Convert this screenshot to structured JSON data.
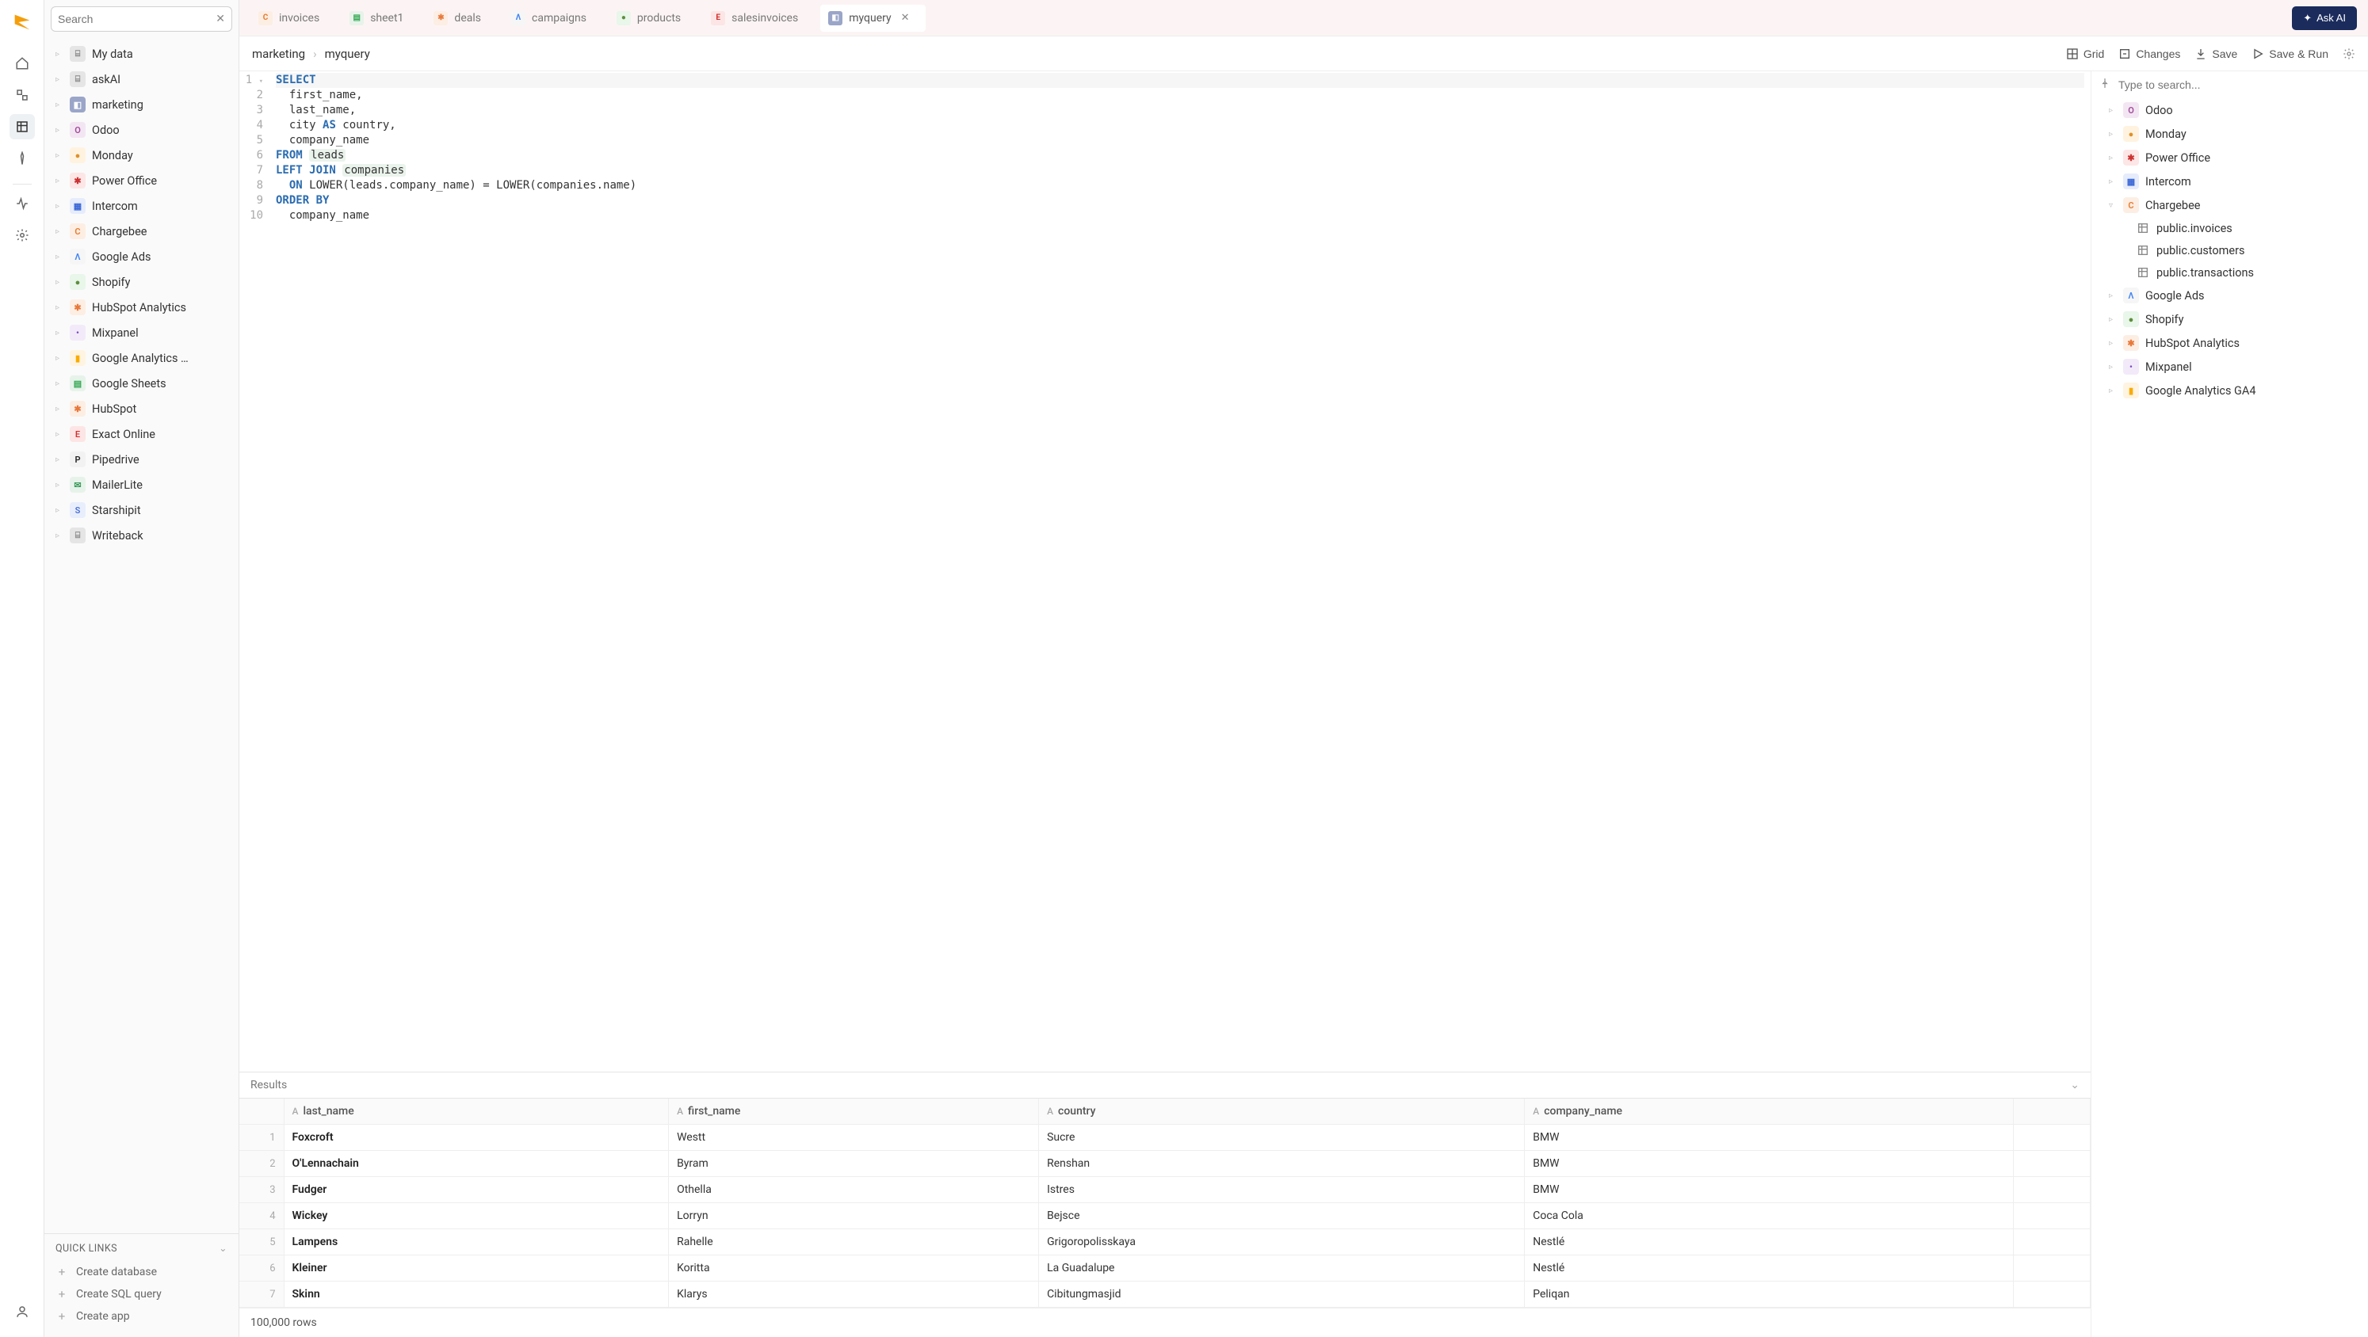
{
  "search": {
    "placeholder": "Search"
  },
  "sidebar": {
    "items": [
      {
        "label": "My data",
        "iconBg": "#e5e5e5",
        "iconFg": "#888",
        "glyph": "⌸"
      },
      {
        "label": "askAI",
        "iconBg": "#e5e5e5",
        "iconFg": "#888",
        "glyph": "⌸"
      },
      {
        "label": "marketing",
        "iconBg": "#9aa5c8",
        "iconFg": "#fff",
        "glyph": "◧"
      },
      {
        "label": "Odoo",
        "iconBg": "#f3e6f3",
        "iconFg": "#a24a9a",
        "glyph": "O"
      },
      {
        "label": "Monday",
        "iconBg": "#fff3e0",
        "iconFg": "#e08f2a",
        "glyph": "●"
      },
      {
        "label": "Power Office",
        "iconBg": "#fde6e6",
        "iconFg": "#c33",
        "glyph": "✱"
      },
      {
        "label": "Intercom",
        "iconBg": "#e6ecfb",
        "iconFg": "#3a66d6",
        "glyph": "▦"
      },
      {
        "label": "Chargebee",
        "iconBg": "#fdeee3",
        "iconFg": "#e77b2f",
        "glyph": "C"
      },
      {
        "label": "Google Ads",
        "iconBg": "#f6f6f6",
        "iconFg": "#4285f4",
        "glyph": "Λ"
      },
      {
        "label": "Shopify",
        "iconBg": "#e9f6ea",
        "iconFg": "#5e8e3e",
        "glyph": "●"
      },
      {
        "label": "HubSpot Analytics",
        "iconBg": "#fdeee4",
        "iconFg": "#e8793b",
        "glyph": "✱"
      },
      {
        "label": "Mixpanel",
        "iconBg": "#f2eaf9",
        "iconFg": "#7b49c6",
        "glyph": "•"
      },
      {
        "label": "Google Analytics …",
        "iconBg": "#fff4e1",
        "iconFg": "#f9ab00",
        "glyph": "▮"
      },
      {
        "label": "Google Sheets",
        "iconBg": "#e7f3ea",
        "iconFg": "#34a853",
        "glyph": "▤"
      },
      {
        "label": "HubSpot",
        "iconBg": "#fdeee4",
        "iconFg": "#e8793b",
        "glyph": "✱"
      },
      {
        "label": "Exact Online",
        "iconBg": "#fde5e5",
        "iconFg": "#d32f2f",
        "glyph": "E"
      },
      {
        "label": "Pipedrive",
        "iconBg": "#f2f2f2",
        "iconFg": "#222",
        "glyph": "P"
      },
      {
        "label": "MailerLite",
        "iconBg": "#e7f3ea",
        "iconFg": "#3a9a5a",
        "glyph": "✉"
      },
      {
        "label": "Starshipit",
        "iconBg": "#e8eefc",
        "iconFg": "#4a6fd6",
        "glyph": "S"
      },
      {
        "label": "Writeback",
        "iconBg": "#e5e5e5",
        "iconFg": "#888",
        "glyph": "⌸"
      }
    ]
  },
  "quickLinks": {
    "title": "QUICK LINKS",
    "items": [
      {
        "label": "Create database"
      },
      {
        "label": "Create SQL query"
      },
      {
        "label": "Create app"
      }
    ]
  },
  "tabs": [
    {
      "label": "invoices",
      "iconBg": "#fdeee3",
      "iconFg": "#e77b2f",
      "glyph": "C"
    },
    {
      "label": "sheet1",
      "iconBg": "#e7f3ea",
      "iconFg": "#34a853",
      "glyph": "▤"
    },
    {
      "label": "deals",
      "iconBg": "#fdeee4",
      "iconFg": "#e8793b",
      "glyph": "✱"
    },
    {
      "label": "campaigns",
      "iconBg": "#f6f6f6",
      "iconFg": "#4285f4",
      "glyph": "Λ"
    },
    {
      "label": "products",
      "iconBg": "#e9f6ea",
      "iconFg": "#5e8e3e",
      "glyph": "●"
    },
    {
      "label": "salesinvoices",
      "iconBg": "#fde5e5",
      "iconFg": "#d32f2f",
      "glyph": "E"
    },
    {
      "label": "myquery",
      "iconBg": "#9aa5c8",
      "iconFg": "#fff",
      "glyph": "◧",
      "active": true,
      "closable": true
    }
  ],
  "askAI": {
    "label": "Ask AI"
  },
  "breadcrumbs": {
    "parent": "marketing",
    "current": "myquery"
  },
  "toolbar": {
    "grid": "Grid",
    "changes": "Changes",
    "save": "Save",
    "saveRun": "Save & Run"
  },
  "editor": {
    "lines": [
      [
        {
          "t": "SELECT",
          "c": "kw"
        }
      ],
      [
        {
          "t": "  first_name,",
          "c": ""
        }
      ],
      [
        {
          "t": "  last_name,",
          "c": ""
        }
      ],
      [
        {
          "t": "  city ",
          "c": ""
        },
        {
          "t": "AS",
          "c": "kw"
        },
        {
          "t": " country,",
          "c": ""
        }
      ],
      [
        {
          "t": "  company_name",
          "c": ""
        }
      ],
      [
        {
          "t": "FROM",
          "c": "kw"
        },
        {
          "t": " ",
          "c": ""
        },
        {
          "t": "leads",
          "c": "tbl"
        }
      ],
      [
        {
          "t": "LEFT JOIN",
          "c": "kw"
        },
        {
          "t": " ",
          "c": ""
        },
        {
          "t": "companies",
          "c": "tbl"
        }
      ],
      [
        {
          "t": "  ",
          "c": ""
        },
        {
          "t": "ON",
          "c": "kw"
        },
        {
          "t": " LOWER(leads.company_name) = LOWER(companies.name)",
          "c": ""
        }
      ],
      [
        {
          "t": "ORDER BY",
          "c": "kw"
        }
      ],
      [
        {
          "t": "  company_name",
          "c": ""
        }
      ]
    ]
  },
  "schema": {
    "placeholder": "Type to search...",
    "items": [
      {
        "label": "Odoo",
        "iconBg": "#f3e6f3",
        "iconFg": "#a24a9a",
        "glyph": "O",
        "level": 1
      },
      {
        "label": "Monday",
        "iconBg": "#fff3e0",
        "iconFg": "#e08f2a",
        "glyph": "●",
        "level": 1
      },
      {
        "label": "Power Office",
        "iconBg": "#fde6e6",
        "iconFg": "#c33",
        "glyph": "✱",
        "level": 1
      },
      {
        "label": "Intercom",
        "iconBg": "#e6ecfb",
        "iconFg": "#3a66d6",
        "glyph": "▦",
        "level": 1
      },
      {
        "label": "Chargebee",
        "iconBg": "#fdeee3",
        "iconFg": "#e77b2f",
        "glyph": "C",
        "level": 1,
        "expanded": true
      },
      {
        "label": "public.invoices",
        "level": 2,
        "table": true
      },
      {
        "label": "public.customers",
        "level": 2,
        "table": true
      },
      {
        "label": "public.transactions",
        "level": 2,
        "table": true
      },
      {
        "label": "Google Ads",
        "iconBg": "#f6f6f6",
        "iconFg": "#4285f4",
        "glyph": "Λ",
        "level": 1
      },
      {
        "label": "Shopify",
        "iconBg": "#e9f6ea",
        "iconFg": "#5e8e3e",
        "glyph": "●",
        "level": 1
      },
      {
        "label": "HubSpot Analytics",
        "iconBg": "#fdeee4",
        "iconFg": "#e8793b",
        "glyph": "✱",
        "level": 1
      },
      {
        "label": "Mixpanel",
        "iconBg": "#f2eaf9",
        "iconFg": "#7b49c6",
        "glyph": "•",
        "level": 1
      },
      {
        "label": "Google Analytics GA4",
        "iconBg": "#fff4e1",
        "iconFg": "#f9ab00",
        "glyph": "▮",
        "level": 1
      }
    ]
  },
  "results": {
    "title": "Results",
    "columns": [
      "last_name",
      "first_name",
      "country",
      "company_name"
    ],
    "rows": [
      [
        "Foxcroft",
        "Westt",
        "Sucre",
        "BMW"
      ],
      [
        "O'Lennachain",
        "Byram",
        "Renshan",
        "BMW"
      ],
      [
        "Fudger",
        "Othella",
        "Istres",
        "BMW"
      ],
      [
        "Wickey",
        "Lorryn",
        "Bejsce",
        "Coca Cola"
      ],
      [
        "Lampens",
        "Rahelle",
        "Grigoropolisskaya",
        "Nestlé"
      ],
      [
        "Kleiner",
        "Koritta",
        "La Guadalupe",
        "Nestlé"
      ],
      [
        "Skinn",
        "Klarys",
        "Cibitungmasjid",
        "Peliqan"
      ]
    ],
    "footer": "100,000 rows"
  }
}
